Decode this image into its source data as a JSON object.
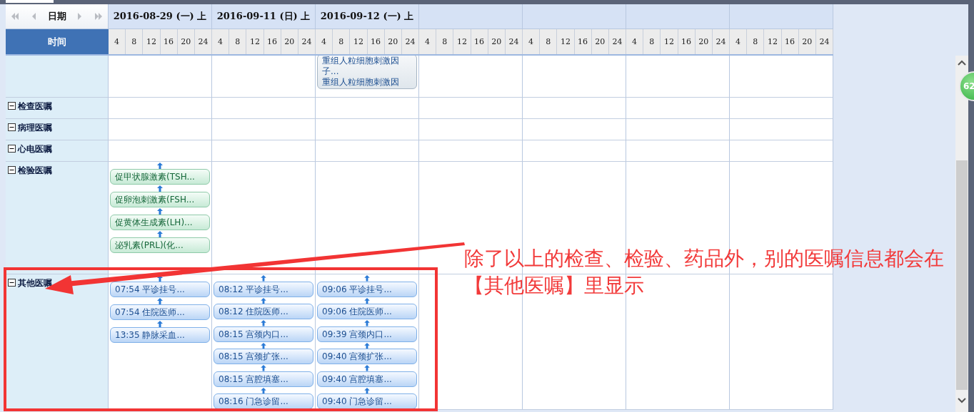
{
  "toolbar": {
    "date_label": "日期",
    "time_label": "时间"
  },
  "days": [
    {
      "date": "2016-08-29 (一) 上",
      "ticks": [
        "4",
        "8",
        "12",
        "16",
        "20",
        "24"
      ]
    },
    {
      "date": "2016-09-11 (日) 上",
      "ticks": [
        "4",
        "8",
        "12",
        "16",
        "20",
        "24"
      ]
    },
    {
      "date": "2016-09-12 (一) 上",
      "ticks": [
        "4",
        "8",
        "12",
        "16",
        "20",
        "24"
      ]
    },
    {
      "ticks": [
        "4",
        "8",
        "12",
        "16",
        "20",
        "24"
      ]
    },
    {
      "ticks": [
        "4",
        "8",
        "12",
        "16",
        "20",
        "24"
      ]
    },
    {
      "ticks": [
        "4",
        "8",
        "12",
        "16",
        "20",
        "24"
      ]
    },
    {
      "ticks": [
        "4",
        "8",
        "12",
        "16",
        "20",
        "24"
      ]
    }
  ],
  "groups": [
    {
      "kind": "drug",
      "day_3": [
        {
          "lines": [
            "重组人粒细胞刺激因",
            "子...",
            "重组人粒细胞刺激因"
          ]
        }
      ]
    },
    {
      "kind": "exam",
      "label": "检查医嘱",
      "expanded": true
    },
    {
      "kind": "exam",
      "label": "病理医嘱",
      "expanded": true
    },
    {
      "kind": "exam",
      "label": "心电医嘱",
      "expanded": true
    },
    {
      "kind": "lab",
      "label": "检验医嘱",
      "expanded": true,
      "day_1": [
        {
          "lines": [
            "促甲状腺激素(TSH..."
          ]
        },
        {
          "lines": [
            "促卵泡刺激素(FSH..."
          ]
        },
        {
          "lines": [
            "促黄体生成素(LH)..."
          ]
        },
        {
          "lines": [
            "泌乳素(PRL)(化..."
          ]
        }
      ]
    },
    {
      "kind": "other",
      "label": "其他医嘱",
      "expanded": true,
      "day_1": [
        {
          "lines": [
            "07:54 平诊挂号..."
          ]
        },
        {
          "lines": [
            "07:54 住院医师..."
          ]
        },
        {
          "lines": [
            "13:35 静脉采血..."
          ]
        }
      ],
      "day_2": [
        {
          "lines": [
            "08:12 平诊挂号..."
          ]
        },
        {
          "lines": [
            "08:12 住院医师..."
          ]
        },
        {
          "lines": [
            "08:15 宫颈内口..."
          ]
        },
        {
          "lines": [
            "08:15 宫颈扩张..."
          ]
        },
        {
          "lines": [
            "08:15 宫腔填塞..."
          ]
        },
        {
          "lines": [
            "08:16 门急诊留..."
          ]
        }
      ],
      "day_3": [
        {
          "lines": [
            "09:06 平诊挂号..."
          ]
        },
        {
          "lines": [
            "09:06 住院医师..."
          ]
        },
        {
          "lines": [
            "09:39 宫颈内口..."
          ]
        },
        {
          "lines": [
            "09:40 宫颈扩张..."
          ]
        },
        {
          "lines": [
            "09:40 宫腔填塞..."
          ]
        },
        {
          "lines": [
            "09:40 门急诊留..."
          ]
        }
      ]
    }
  ],
  "badge": "62",
  "annotation": {
    "text": "除了以上的检查、检验、药品外，别的医嘱信息都会在【其他医嘱】里显示"
  }
}
